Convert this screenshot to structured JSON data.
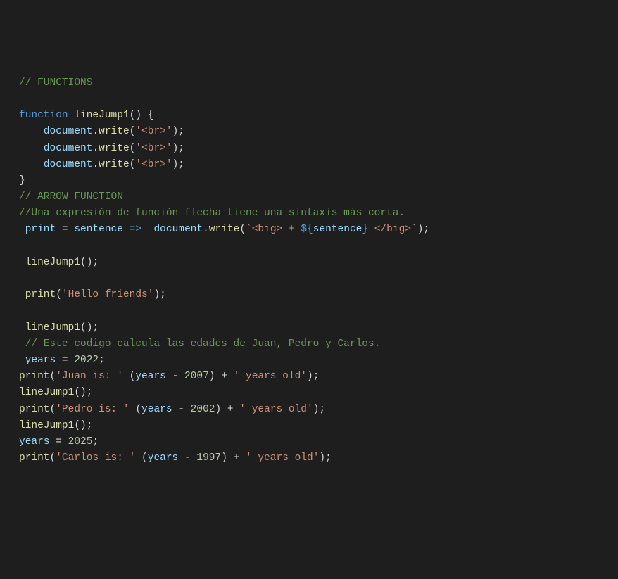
{
  "code": {
    "lines": [
      {
        "indent": 0,
        "tokens": [
          {
            "t": "comment",
            "v": "// FUNCTIONS"
          }
        ]
      },
      {
        "indent": 0,
        "tokens": []
      },
      {
        "indent": 0,
        "tokens": [
          {
            "t": "keyword",
            "v": "function"
          },
          {
            "t": "sp",
            "v": " "
          },
          {
            "t": "funcdecl",
            "v": "lineJump1"
          },
          {
            "t": "paren",
            "v": "()"
          },
          {
            "t": "sp",
            "v": " "
          },
          {
            "t": "brace",
            "v": "{"
          }
        ]
      },
      {
        "indent": 4,
        "tokens": [
          {
            "t": "obj",
            "v": "document"
          },
          {
            "t": "op",
            "v": "."
          },
          {
            "t": "method",
            "v": "write"
          },
          {
            "t": "paren",
            "v": "("
          },
          {
            "t": "string",
            "v": "'<br>'"
          },
          {
            "t": "paren",
            "v": ")"
          },
          {
            "t": "op",
            "v": ";"
          }
        ]
      },
      {
        "indent": 4,
        "tokens": [
          {
            "t": "obj",
            "v": "document"
          },
          {
            "t": "op",
            "v": "."
          },
          {
            "t": "method",
            "v": "write"
          },
          {
            "t": "paren",
            "v": "("
          },
          {
            "t": "string",
            "v": "'<br>'"
          },
          {
            "t": "paren",
            "v": ")"
          },
          {
            "t": "op",
            "v": ";"
          }
        ]
      },
      {
        "indent": 4,
        "tokens": [
          {
            "t": "obj",
            "v": "document"
          },
          {
            "t": "op",
            "v": "."
          },
          {
            "t": "method",
            "v": "write"
          },
          {
            "t": "paren",
            "v": "("
          },
          {
            "t": "string",
            "v": "'<br>'"
          },
          {
            "t": "paren",
            "v": ")"
          },
          {
            "t": "op",
            "v": ";"
          }
        ]
      },
      {
        "indent": 0,
        "tokens": [
          {
            "t": "brace",
            "v": "}"
          }
        ]
      },
      {
        "indent": 0,
        "tokens": [
          {
            "t": "comment",
            "v": "// ARROW FUNCTION"
          }
        ]
      },
      {
        "indent": 0,
        "tokens": [
          {
            "t": "comment",
            "v": "//Una expresión de función flecha tiene una sintaxis más corta."
          }
        ]
      },
      {
        "indent": 1,
        "tokens": [
          {
            "t": "ident",
            "v": "print"
          },
          {
            "t": "sp",
            "v": " "
          },
          {
            "t": "op",
            "v": "="
          },
          {
            "t": "sp",
            "v": " "
          },
          {
            "t": "ident",
            "v": "sentence"
          },
          {
            "t": "sp",
            "v": " "
          },
          {
            "t": "arrow",
            "v": "=>"
          },
          {
            "t": "sp",
            "v": "  "
          },
          {
            "t": "obj",
            "v": "document"
          },
          {
            "t": "op",
            "v": "."
          },
          {
            "t": "method",
            "v": "write"
          },
          {
            "t": "paren",
            "v": "("
          },
          {
            "t": "string",
            "v": "`<big> + "
          },
          {
            "t": "template-braces",
            "v": "${"
          },
          {
            "t": "template-expr",
            "v": "sentence"
          },
          {
            "t": "template-braces",
            "v": "}"
          },
          {
            "t": "string",
            "v": " </big>`"
          },
          {
            "t": "paren",
            "v": ")"
          },
          {
            "t": "op",
            "v": ";"
          }
        ]
      },
      {
        "indent": 0,
        "tokens": []
      },
      {
        "indent": 1,
        "tokens": [
          {
            "t": "method",
            "v": "lineJump1"
          },
          {
            "t": "paren",
            "v": "()"
          },
          {
            "t": "op",
            "v": ";"
          }
        ]
      },
      {
        "indent": 0,
        "tokens": []
      },
      {
        "indent": 1,
        "tokens": [
          {
            "t": "method",
            "v": "print"
          },
          {
            "t": "paren",
            "v": "("
          },
          {
            "t": "string",
            "v": "'Hello friends'"
          },
          {
            "t": "paren",
            "v": ")"
          },
          {
            "t": "op",
            "v": ";"
          }
        ]
      },
      {
        "indent": 0,
        "tokens": []
      },
      {
        "indent": 1,
        "tokens": [
          {
            "t": "method",
            "v": "lineJump1"
          },
          {
            "t": "paren",
            "v": "()"
          },
          {
            "t": "op",
            "v": ";"
          }
        ]
      },
      {
        "indent": 1,
        "tokens": [
          {
            "t": "comment",
            "v": "// Este codigo calcula las edades de Juan, Pedro y Carlos."
          }
        ]
      },
      {
        "indent": 1,
        "tokens": [
          {
            "t": "ident",
            "v": "years"
          },
          {
            "t": "sp",
            "v": " "
          },
          {
            "t": "op",
            "v": "="
          },
          {
            "t": "sp",
            "v": " "
          },
          {
            "t": "number",
            "v": "2022"
          },
          {
            "t": "op",
            "v": ";"
          }
        ]
      },
      {
        "indent": 0,
        "tokens": [
          {
            "t": "method",
            "v": "print"
          },
          {
            "t": "paren",
            "v": "("
          },
          {
            "t": "string",
            "v": "'Juan is: '"
          },
          {
            "t": "sp",
            "v": " "
          },
          {
            "t": "paren",
            "v": "("
          },
          {
            "t": "ident",
            "v": "years"
          },
          {
            "t": "sp",
            "v": " "
          },
          {
            "t": "op",
            "v": "-"
          },
          {
            "t": "sp",
            "v": " "
          },
          {
            "t": "number",
            "v": "2007"
          },
          {
            "t": "paren",
            "v": ")"
          },
          {
            "t": "sp",
            "v": " "
          },
          {
            "t": "op",
            "v": "+"
          },
          {
            "t": "sp",
            "v": " "
          },
          {
            "t": "string",
            "v": "' years old'"
          },
          {
            "t": "paren",
            "v": ")"
          },
          {
            "t": "op",
            "v": ";"
          }
        ]
      },
      {
        "indent": 0,
        "tokens": [
          {
            "t": "method",
            "v": "lineJump1"
          },
          {
            "t": "paren",
            "v": "()"
          },
          {
            "t": "op",
            "v": ";"
          }
        ]
      },
      {
        "indent": 0,
        "tokens": [
          {
            "t": "method",
            "v": "print"
          },
          {
            "t": "paren",
            "v": "("
          },
          {
            "t": "string",
            "v": "'Pedro is: '"
          },
          {
            "t": "sp",
            "v": " "
          },
          {
            "t": "paren",
            "v": "("
          },
          {
            "t": "ident",
            "v": "years"
          },
          {
            "t": "sp",
            "v": " "
          },
          {
            "t": "op",
            "v": "-"
          },
          {
            "t": "sp",
            "v": " "
          },
          {
            "t": "number",
            "v": "2002"
          },
          {
            "t": "paren",
            "v": ")"
          },
          {
            "t": "sp",
            "v": " "
          },
          {
            "t": "op",
            "v": "+"
          },
          {
            "t": "sp",
            "v": " "
          },
          {
            "t": "string",
            "v": "' years old'"
          },
          {
            "t": "paren",
            "v": ")"
          },
          {
            "t": "op",
            "v": ";"
          }
        ]
      },
      {
        "indent": 0,
        "tokens": [
          {
            "t": "method",
            "v": "lineJump1"
          },
          {
            "t": "paren",
            "v": "()"
          },
          {
            "t": "op",
            "v": ";"
          }
        ]
      },
      {
        "indent": 0,
        "tokens": [
          {
            "t": "ident",
            "v": "years"
          },
          {
            "t": "sp",
            "v": " "
          },
          {
            "t": "op",
            "v": "="
          },
          {
            "t": "sp",
            "v": " "
          },
          {
            "t": "number",
            "v": "2025"
          },
          {
            "t": "op",
            "v": ";"
          }
        ]
      },
      {
        "indent": 0,
        "tokens": [
          {
            "t": "method",
            "v": "print"
          },
          {
            "t": "paren",
            "v": "("
          },
          {
            "t": "string",
            "v": "'Carlos is: '"
          },
          {
            "t": "sp",
            "v": " "
          },
          {
            "t": "paren",
            "v": "("
          },
          {
            "t": "ident",
            "v": "years"
          },
          {
            "t": "sp",
            "v": " "
          },
          {
            "t": "op",
            "v": "-"
          },
          {
            "t": "sp",
            "v": " "
          },
          {
            "t": "number",
            "v": "1997"
          },
          {
            "t": "paren",
            "v": ")"
          },
          {
            "t": "sp",
            "v": " "
          },
          {
            "t": "op",
            "v": "+"
          },
          {
            "t": "sp",
            "v": " "
          },
          {
            "t": "string",
            "v": "' years old'"
          },
          {
            "t": "paren",
            "v": ")"
          },
          {
            "t": "op",
            "v": ";"
          }
        ]
      }
    ]
  }
}
